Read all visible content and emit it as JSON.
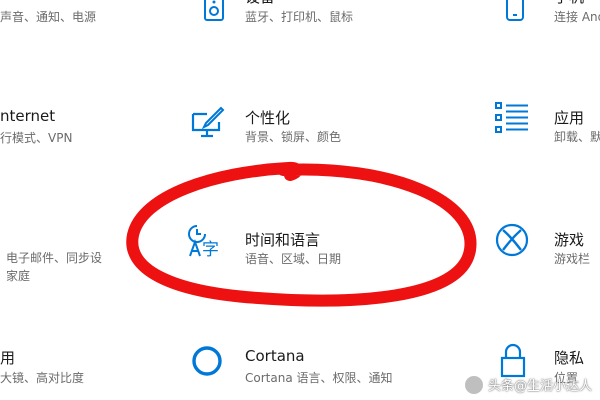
{
  "colors": {
    "accent": "#0078d7",
    "annotation": "#ee1111"
  },
  "tiles": {
    "system": {
      "desc": "声音、通知、电源"
    },
    "devices": {
      "title": "设备",
      "desc": "蓝牙、打印机、鼠标",
      "icon": "keyboard-speaker-icon"
    },
    "phone": {
      "title": "手机",
      "desc": "连接 Android",
      "icon": "phone-icon"
    },
    "network": {
      "title": "nternet",
      "desc": "行模式、VPN"
    },
    "personalization": {
      "title": "个性化",
      "desc": "背景、锁屏、颜色",
      "icon": "paint-monitor-icon"
    },
    "apps": {
      "title": "应用",
      "desc": "卸载、默",
      "icon": "list-icon"
    },
    "accounts": {
      "desc1": "电子邮件、同步设",
      "desc2": "家庭"
    },
    "time_language": {
      "title": "时间和语言",
      "desc": "语音、区域、日期",
      "icon": "time-language-icon"
    },
    "gaming": {
      "title": "游戏",
      "desc": "游戏栏",
      "icon": "xbox-icon"
    },
    "ease": {
      "title": "用",
      "desc": "大镜、高对比度"
    },
    "cortana": {
      "title": "Cortana",
      "desc": "Cortana 语言、权限、通知",
      "icon": "cortana-ring-icon"
    },
    "privacy": {
      "title": "隐私",
      "desc": "位置",
      "icon": "lock-icon"
    }
  },
  "watermark": {
    "text": "头条@生活小达人"
  }
}
